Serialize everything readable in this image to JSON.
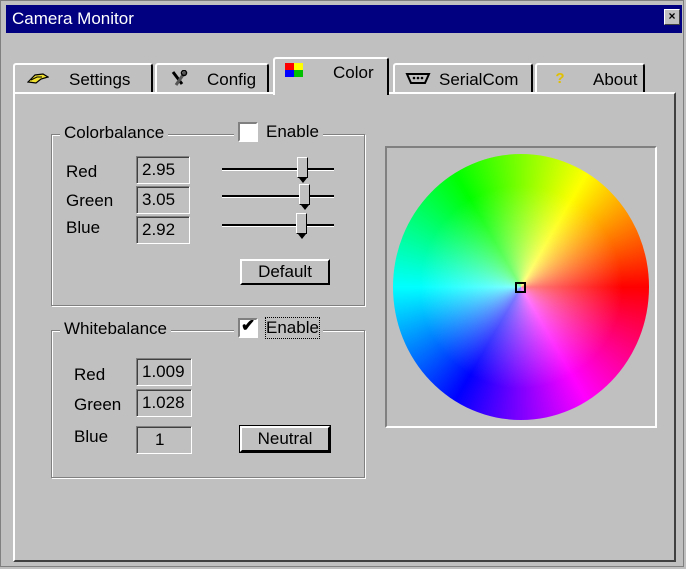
{
  "window": {
    "title": "Camera Monitor",
    "close_glyph": "×",
    "close_icon": "close-icon"
  },
  "tabs": [
    {
      "label": "Settings",
      "icon": "hand-icon"
    },
    {
      "label": "Config",
      "icon": "tools-icon"
    },
    {
      "label": "Color",
      "icon": "color-icon",
      "active": true
    },
    {
      "label": "SerialCom",
      "icon": "serial-port-icon"
    },
    {
      "label": "About",
      "icon": "question-icon"
    }
  ],
  "colorbalance": {
    "title": "Colorbalance",
    "enable_label": "Enable",
    "enabled": false,
    "red_label": "Red",
    "red_value": "2.95",
    "green_label": "Green",
    "green_value": "3.05",
    "blue_label": "Blue",
    "blue_value": "2.92",
    "red_slider": 0.74,
    "green_slider": 0.76,
    "blue_slider": 0.73,
    "default_label": "Default"
  },
  "whitebalance": {
    "title": "Whitebalance",
    "enable_label": "Enable",
    "enabled": true,
    "red_label": "Red",
    "red_value": "1.009",
    "green_label": "Green",
    "green_value": "1.028",
    "blue_label": "Blue",
    "blue_value": "1",
    "neutral_label": "Neutral"
  },
  "colorwheel": {
    "marker_color": "#000000"
  },
  "colors": {
    "titlebar": "#000080",
    "face": "#c0c0c0"
  }
}
